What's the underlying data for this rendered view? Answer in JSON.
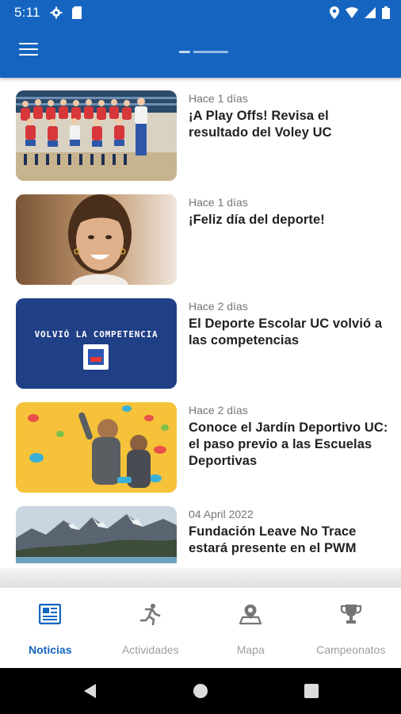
{
  "status_bar": {
    "time": "5:11"
  },
  "news": [
    {
      "date": "Hace 1 días",
      "title": "¡A Play Offs! Revisa el resultado del Voley UC"
    },
    {
      "date": "Hace 1 días",
      "title": "¡Feliz día del deporte!"
    },
    {
      "date": "Hace 2 días",
      "title": "El Deporte Escolar UC volvió a las competencias",
      "thumb_text": "VOLVIÓ LA COMPETENCIA"
    },
    {
      "date": "Hace 2 días",
      "title": "Conoce el Jardín Deportivo UC: el paso previo a las Escuelas Deportivas"
    },
    {
      "date": "04 April 2022",
      "title": "Fundación Leave No Trace estará presente en el PWM"
    }
  ],
  "bottom_nav": [
    {
      "label": "Noticias",
      "icon": "newspaper-icon",
      "active": true
    },
    {
      "label": "Actividades",
      "icon": "running-icon",
      "active": false
    },
    {
      "label": "Mapa",
      "icon": "map-pin-icon",
      "active": false
    },
    {
      "label": "Campeonatos",
      "icon": "trophy-icon",
      "active": false
    }
  ],
  "colors": {
    "primary": "#1565c0",
    "inactive": "#9e9e9e"
  }
}
